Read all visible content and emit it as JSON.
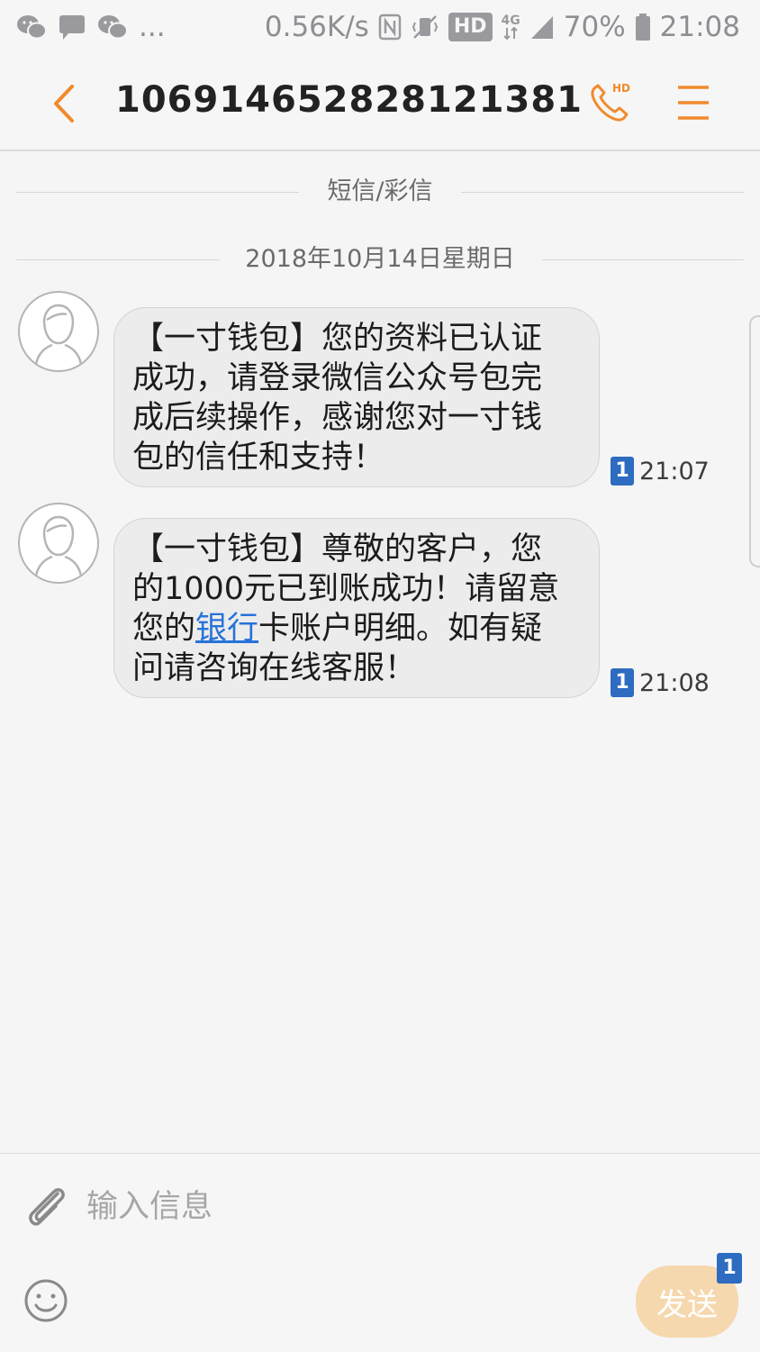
{
  "status_bar": {
    "speed": "0.56K/s",
    "hd": "HD",
    "network": "4G",
    "battery": "70%",
    "time": "21:08",
    "more": "..."
  },
  "header": {
    "title": "106914652828121381"
  },
  "dividers": {
    "type_label": "短信/彩信",
    "date_label": "2018年10月14日星期日"
  },
  "messages": [
    {
      "text": "【一寸钱包】您的资料已认证成功，请登录微信公众号包完成后续操作，感谢您对一寸钱包的信任和支持！",
      "sim": "1",
      "time": "21:07"
    },
    {
      "text_before": "【一寸钱包】尊敬的客户，您的1000元已到账成功！请留意您的",
      "link": "银行",
      "text_after": "卡账户明细。如有疑问请咨询在线客服！",
      "sim": "1",
      "time": "21:08"
    }
  ],
  "compose": {
    "placeholder": "输入信息",
    "send_label": "发送",
    "send_sim": "1"
  },
  "colors": {
    "accent": "#f08a2c",
    "sim_badge": "#2d6cc0",
    "link": "#2773d9"
  }
}
